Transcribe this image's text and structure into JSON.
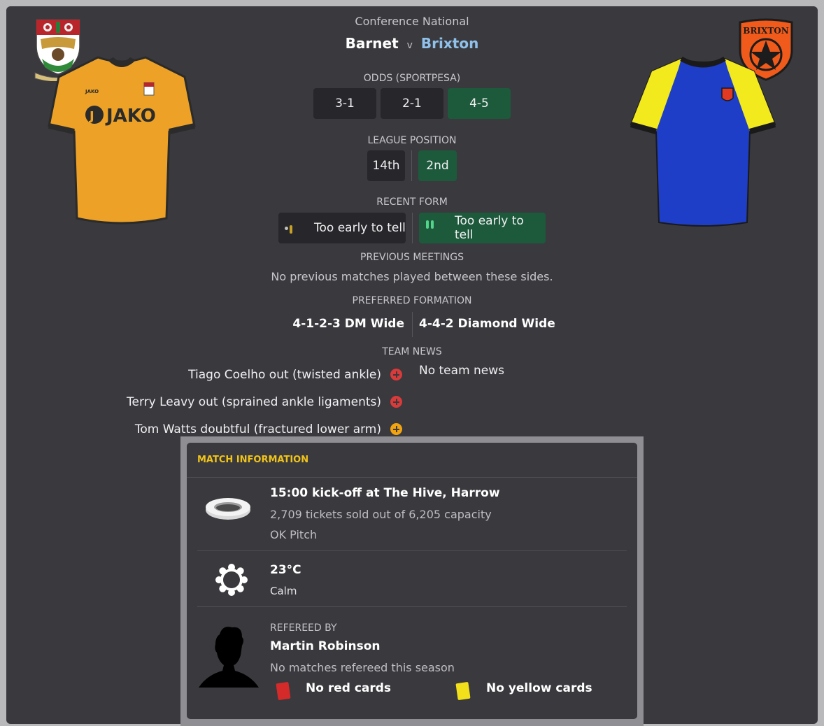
{
  "header": {
    "competition": "Conference National",
    "home_team": "Barnet",
    "versus": "v",
    "away_team": "Brixton"
  },
  "odds": {
    "title": "ODDS (SPORTPESA)",
    "home": "3-1",
    "draw": "2-1",
    "away": "4-5"
  },
  "league_position": {
    "title": "LEAGUE POSITION",
    "home": "14th",
    "away": "2nd"
  },
  "recent_form": {
    "title": "RECENT FORM",
    "home": "Too early to tell",
    "away": "Too early to tell"
  },
  "previous_meetings": {
    "title": "PREVIOUS MEETINGS",
    "text": "No previous matches played between these sides."
  },
  "formation": {
    "title": "PREFERRED FORMATION",
    "home": "4-1-2-3 DM Wide",
    "away": "4-4-2 Diamond Wide"
  },
  "team_news": {
    "title": "TEAM NEWS",
    "home": [
      {
        "text": "Tiago Coelho out (twisted ankle)",
        "severity": "out"
      },
      {
        "text": "Terry Leavy out (sprained ankle ligaments)",
        "severity": "out"
      },
      {
        "text": "Tom Watts doubtful (fractured lower arm)",
        "severity": "doubtful"
      }
    ],
    "away": "No team news"
  },
  "badges": {
    "away_badge_text": "BRIXTON"
  },
  "kits": {
    "home_sponsor": "JAKO",
    "home_brand": "JAKO"
  },
  "match_info": {
    "title": "MATCH INFORMATION",
    "venue": {
      "icon": "stadium-icon",
      "headline": "15:00 kick-off at The Hive, Harrow",
      "tickets": "2,709 tickets sold out of 6,205 capacity",
      "pitch": "OK Pitch"
    },
    "weather": {
      "icon": "sun-icon",
      "temperature": "23°C",
      "wind": "Calm"
    },
    "referee": {
      "icon": "referee-silhouette-icon",
      "title": "REFEREED BY",
      "name": "Martin Robinson",
      "note": "No matches refereed this season",
      "red_cards": "No red cards",
      "yellow_cards": "No yellow cards"
    }
  },
  "colors": {
    "accent_green": "#1d5a3c",
    "away_team_blue": "#8fc1ea",
    "section_gold": "#f0c419",
    "injury_red": "#d93a3a",
    "doubtful_amber": "#f2a410"
  }
}
